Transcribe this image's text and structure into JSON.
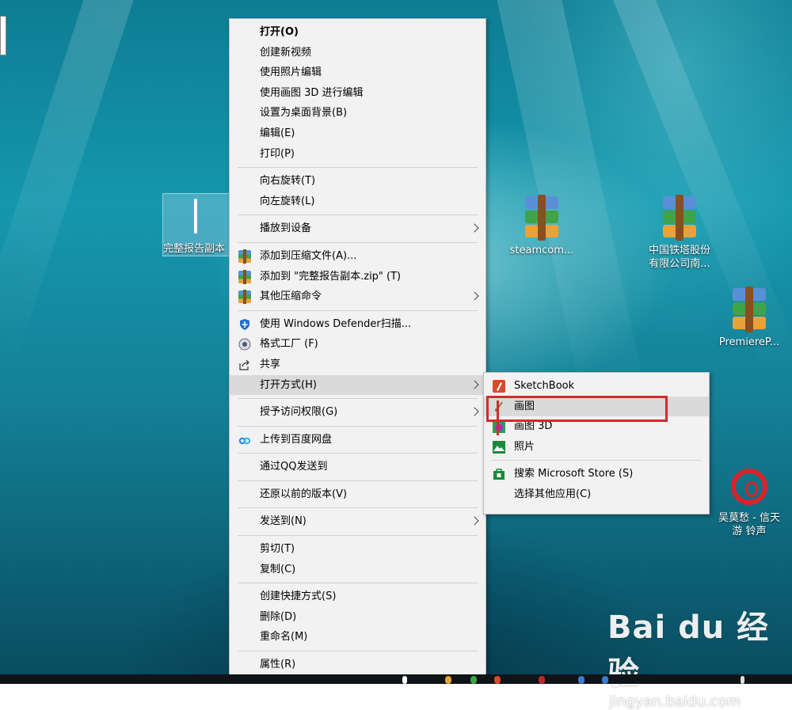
{
  "desktop": {
    "selected_file_label": "完整报告副本",
    "icons": [
      {
        "label": "steamcom..."
      },
      {
        "label": "中国铁塔股份\n有限公司南..."
      },
      {
        "label": "PremiereP..."
      },
      {
        "label": "吴莫愁 - 信天\n游 铃声"
      }
    ]
  },
  "context_menu": {
    "groups": [
      [
        {
          "label": "打开(O)",
          "icon": "",
          "bold": true
        },
        {
          "label": "创建新视频",
          "icon": ""
        },
        {
          "label": "使用照片编辑",
          "icon": ""
        },
        {
          "label": "使用画图 3D 进行编辑",
          "icon": ""
        },
        {
          "label": "设置为桌面背景(B)",
          "icon": ""
        },
        {
          "label": "编辑(E)",
          "icon": ""
        },
        {
          "label": "打印(P)",
          "icon": ""
        }
      ],
      [
        {
          "label": "向右旋转(T)",
          "icon": ""
        },
        {
          "label": "向左旋转(L)",
          "icon": ""
        }
      ],
      [
        {
          "label": "播放到设备",
          "icon": "",
          "submenu": true
        }
      ],
      [
        {
          "label": "添加到压缩文件(A)...",
          "icon": "winrar-icon"
        },
        {
          "label": "添加到 \"完整报告副本.zip\" (T)",
          "icon": "winrar-icon"
        },
        {
          "label": "其他压缩命令",
          "icon": "winrar-icon",
          "submenu": true
        }
      ],
      [
        {
          "label": "使用 Windows Defender扫描...",
          "icon": "defender-shield-icon"
        },
        {
          "label": "格式工厂 (F)",
          "icon": "format-factory-icon"
        },
        {
          "label": "共享",
          "icon": "share-icon"
        },
        {
          "label": "打开方式(H)",
          "icon": "",
          "submenu": true,
          "highlighted": true
        }
      ],
      [
        {
          "label": "授予访问权限(G)",
          "icon": "",
          "submenu": true
        }
      ],
      [
        {
          "label": "上传到百度网盘",
          "icon": "baidu-netdisk-icon"
        }
      ],
      [
        {
          "label": "通过QQ发送到",
          "icon": ""
        }
      ],
      [
        {
          "label": "还原以前的版本(V)",
          "icon": ""
        }
      ],
      [
        {
          "label": "发送到(N)",
          "icon": "",
          "submenu": true
        }
      ],
      [
        {
          "label": "剪切(T)",
          "icon": ""
        },
        {
          "label": "复制(C)",
          "icon": ""
        }
      ],
      [
        {
          "label": "创建快捷方式(S)",
          "icon": ""
        },
        {
          "label": "删除(D)",
          "icon": ""
        },
        {
          "label": "重命名(M)",
          "icon": ""
        }
      ],
      [
        {
          "label": "属性(R)",
          "icon": ""
        }
      ]
    ]
  },
  "open_with_submenu": {
    "items": [
      {
        "label": "SketchBook",
        "icon": "sketchbook-icon"
      },
      {
        "label": "画图",
        "icon": "paint-icon",
        "highlighted": true
      },
      {
        "label": "画图 3D",
        "icon": "paint-3d-icon"
      },
      {
        "label": "照片",
        "icon": "photos-icon"
      }
    ],
    "store_items": [
      {
        "label": "搜索 Microsoft Store (S)",
        "icon": "microsoft-store-icon"
      },
      {
        "label": "选择其他应用(C)",
        "icon": ""
      }
    ]
  },
  "watermark": {
    "brand": "Bai du 经验",
    "url": "jingyan.baidu.com"
  },
  "colors": {
    "menu_bg": "#f2f2f2",
    "highlight": "#dadada",
    "annotation_red": "#d42a2a"
  }
}
